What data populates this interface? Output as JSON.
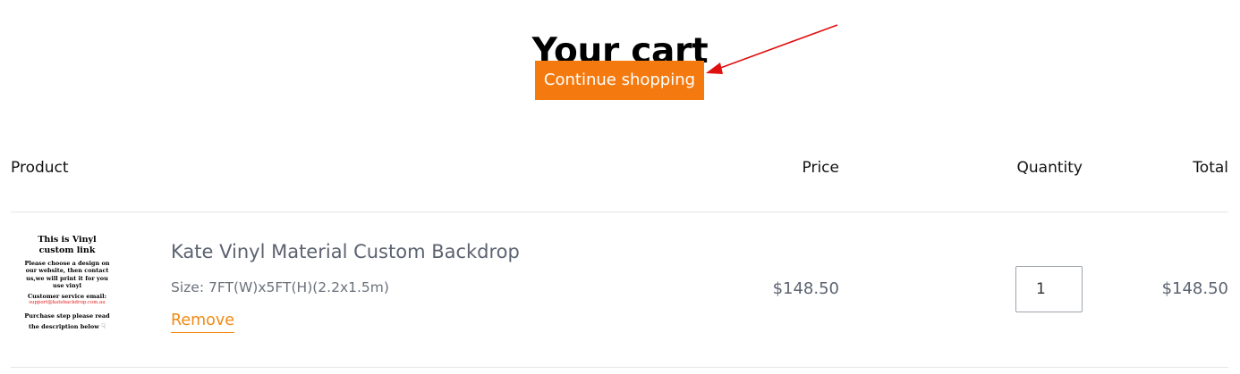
{
  "page": {
    "title": "Your cart",
    "continue_label": "Continue shopping"
  },
  "annotation": {
    "color": "#e01010"
  },
  "colors": {
    "accent": "#f47a0f",
    "link": "#f08a14"
  },
  "table": {
    "headers": [
      "Product",
      "Price",
      "Quantity",
      "Total"
    ]
  },
  "cart": {
    "items": [
      {
        "name": "Kate Vinyl Material Custom Backdrop",
        "variant": "Size: 7FT(W)x5FT(H)(2.2x1.5m)",
        "remove_label": "Remove",
        "price": "$148.50",
        "quantity": "1",
        "total": "$148.50",
        "image": {
          "line1": "This is Vinyl",
          "line2": "custom link",
          "line3": "Please choose a design on",
          "line4": "our website, then contact",
          "line5": "us,we will print it for you",
          "line6": "use vinyl",
          "line7": "Customer service email:",
          "line8": "support@katebackdrop.com.au",
          "line9": "Purchase step please read",
          "line10": "the description below"
        }
      }
    ]
  }
}
